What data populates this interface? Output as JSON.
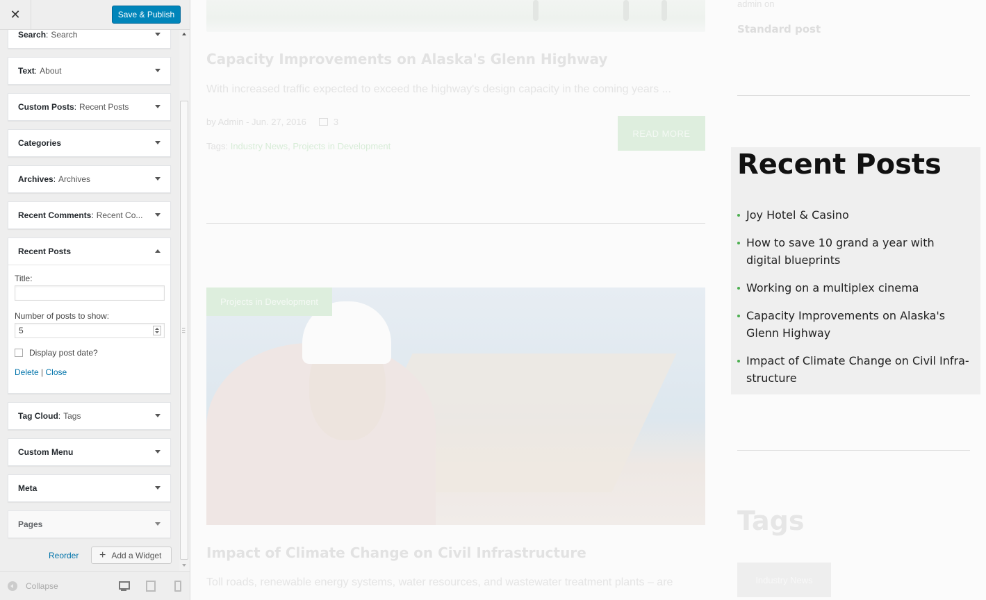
{
  "customizer": {
    "close_glyph": "✕",
    "save_label": "Save & Publish",
    "widgets": [
      {
        "name": "Search",
        "sub": "Search"
      },
      {
        "name": "Text",
        "sub": "About"
      },
      {
        "name": "Custom Posts",
        "sub": "Recent Posts"
      },
      {
        "name": "Categories",
        "sub": ""
      },
      {
        "name": "Archives",
        "sub": "Archives"
      },
      {
        "name": "Recent Comments",
        "sub": "Recent Co..."
      },
      {
        "name": "Recent Posts",
        "sub": ""
      },
      {
        "name": "Tag Cloud",
        "sub": "Tags"
      },
      {
        "name": "Custom Menu",
        "sub": ""
      },
      {
        "name": "Meta",
        "sub": ""
      },
      {
        "name": "Pages",
        "sub": ""
      }
    ],
    "form": {
      "title_label": "Title:",
      "title_value": "",
      "count_label": "Number of posts to show:",
      "count_value": "5",
      "date_label": "Display post date?",
      "delete": "Delete",
      "sep": "|",
      "close": "Close"
    },
    "reorder": "Reorder",
    "add_widget_plus": "+",
    "add_widget": "Add a Widget",
    "collapse": "Collapse"
  },
  "preview": {
    "post1": {
      "title": "Capacity Improvements on Alaska's Glenn Highway",
      "excerpt": "With increased traffic expected to exceed the highway's design capacity in the coming years ...",
      "meta": "by Admin - Jun. 27, 2016",
      "comments": "3",
      "tags_label": "Tags:",
      "tag1": "Industry News",
      "tag_sep": ",",
      "tag2": "Projects in Development",
      "read_more": "READ MORE"
    },
    "post2": {
      "badge": "Projects in Development",
      "title": "Impact of Climate Change on Civil Infrastructure",
      "excerpt": "Toll roads, renewable energy systems, water resources, and wastewater treatment plants – are"
    },
    "sidebar": {
      "admin_on": "admin on",
      "standard_post": "Standard post",
      "recent_title": "Recent Posts",
      "recent_items": [
        "Joy Hotel & Casino",
        "How to save 10 grand a year with digital blueprints",
        "Working on a multiplex cinema",
        "Capacity Improvements on Alaska's Glenn Highway",
        "Impact of Climate Change on Civil Infra-structure"
      ],
      "tags_title": "Tags",
      "tag_pill": "Industry News"
    }
  }
}
